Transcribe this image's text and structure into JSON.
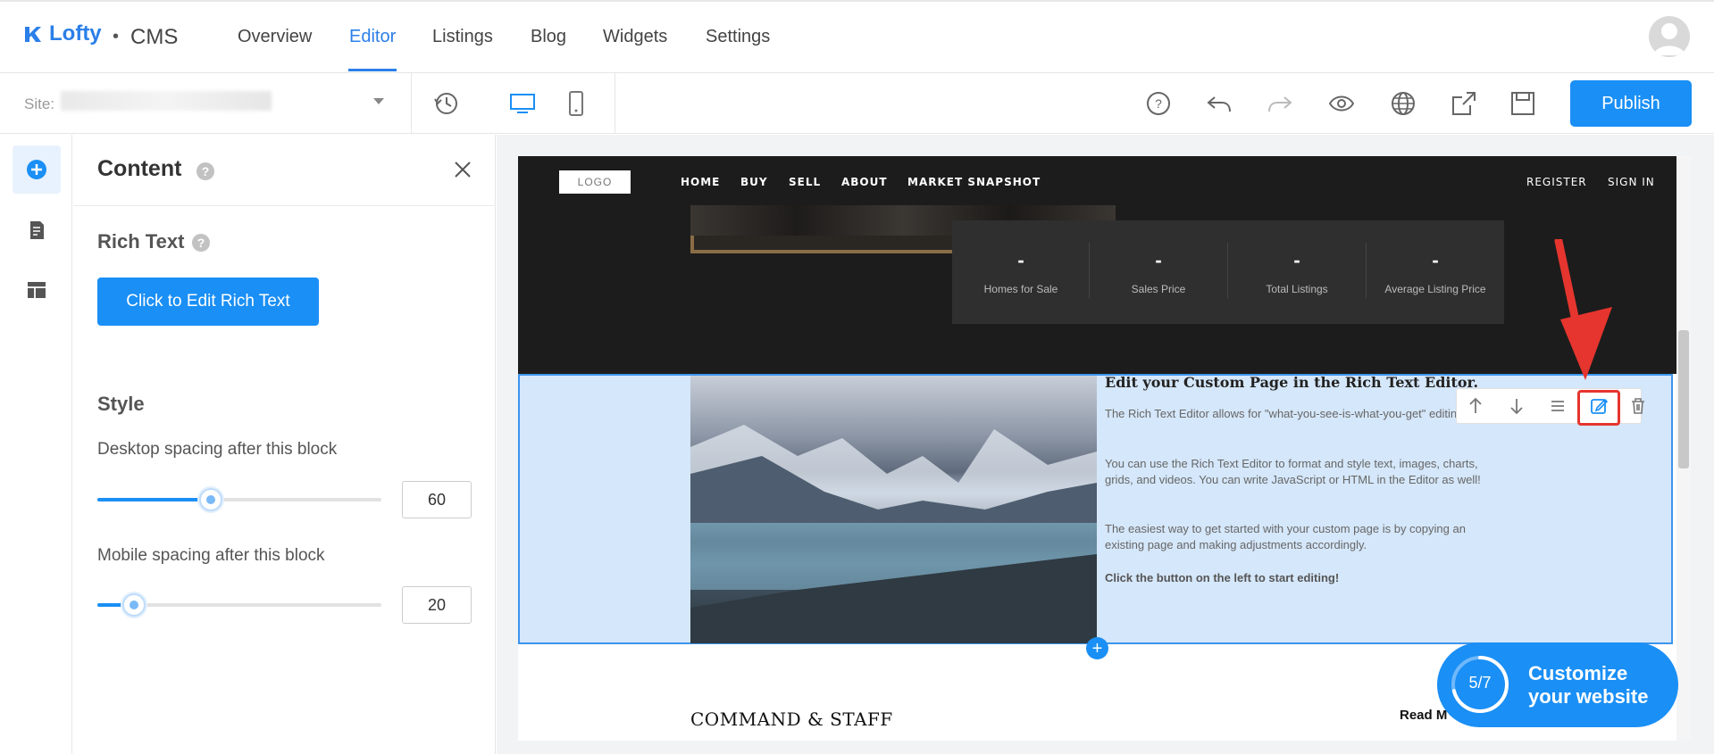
{
  "header": {
    "brand": "Lofty",
    "separator": "•",
    "product": "CMS",
    "tabs": [
      {
        "label": "Overview"
      },
      {
        "label": "Editor",
        "active": true
      },
      {
        "label": "Listings"
      },
      {
        "label": "Blog"
      },
      {
        "label": "Widgets"
      },
      {
        "label": "Settings"
      }
    ]
  },
  "toolbar": {
    "site_label": "Site:",
    "publish_label": "Publish",
    "icons": [
      "history-icon",
      "desktop-icon",
      "mobile-icon",
      "help-icon",
      "undo-icon",
      "redo-icon",
      "preview-icon",
      "globe-icon",
      "share-icon",
      "save-icon"
    ]
  },
  "rail": {
    "icons": [
      "add-icon",
      "page-icon",
      "layout-icon"
    ]
  },
  "panel": {
    "title": "Content",
    "rich_text_heading": "Rich Text",
    "edit_button": "Click to Edit Rich Text",
    "style_heading": "Style",
    "desktop_label": "Desktop spacing after this block",
    "desktop_value": "60",
    "desktop_fraction": 0.4,
    "mobile_label": "Mobile spacing after this block",
    "mobile_value": "20",
    "mobile_fraction": 0.13
  },
  "preview": {
    "logo": "LOGO",
    "nav": [
      "HOME",
      "BUY",
      "SELL",
      "ABOUT",
      "MARKET SNAPSHOT"
    ],
    "nav_right": [
      "REGISTER",
      "SIGN IN"
    ],
    "stats": [
      {
        "value": "-",
        "label": "Homes for Sale"
      },
      {
        "value": "-",
        "label": "Sales Price"
      },
      {
        "value": "-",
        "label": "Total Listings"
      },
      {
        "value": "-",
        "label": "Average Listing Price"
      }
    ],
    "rich_text": {
      "title": "Edit your Custom Page in the Rich Text Editor.",
      "p1": "The Rich Text Editor allows for \"what-you-see-is-what-you-get\" editing.",
      "p2": "You can use the Rich Text Editor to format and style text, images, charts, grids, and videos. You can write JavaScript or HTML in the Editor as well!",
      "p3": "The easiest way to get started with your custom page is by copying an existing page and making adjustments accordingly.",
      "cta": "Click the button on the left to start editing!"
    },
    "block_tools": [
      "move-up-icon",
      "move-down-icon",
      "align-icon",
      "edit-icon",
      "delete-icon"
    ],
    "section_title": "COMMAND & STAFF",
    "read_more": "Read M",
    "add_plus": "+"
  },
  "customize": {
    "line1": "Customize",
    "line2": "your website",
    "progress": "5/7",
    "fraction": 0.71
  },
  "colors": {
    "accent": "#1a8ff5",
    "highlight": "#e5352e",
    "hero_bg": "#1c1c1c"
  }
}
